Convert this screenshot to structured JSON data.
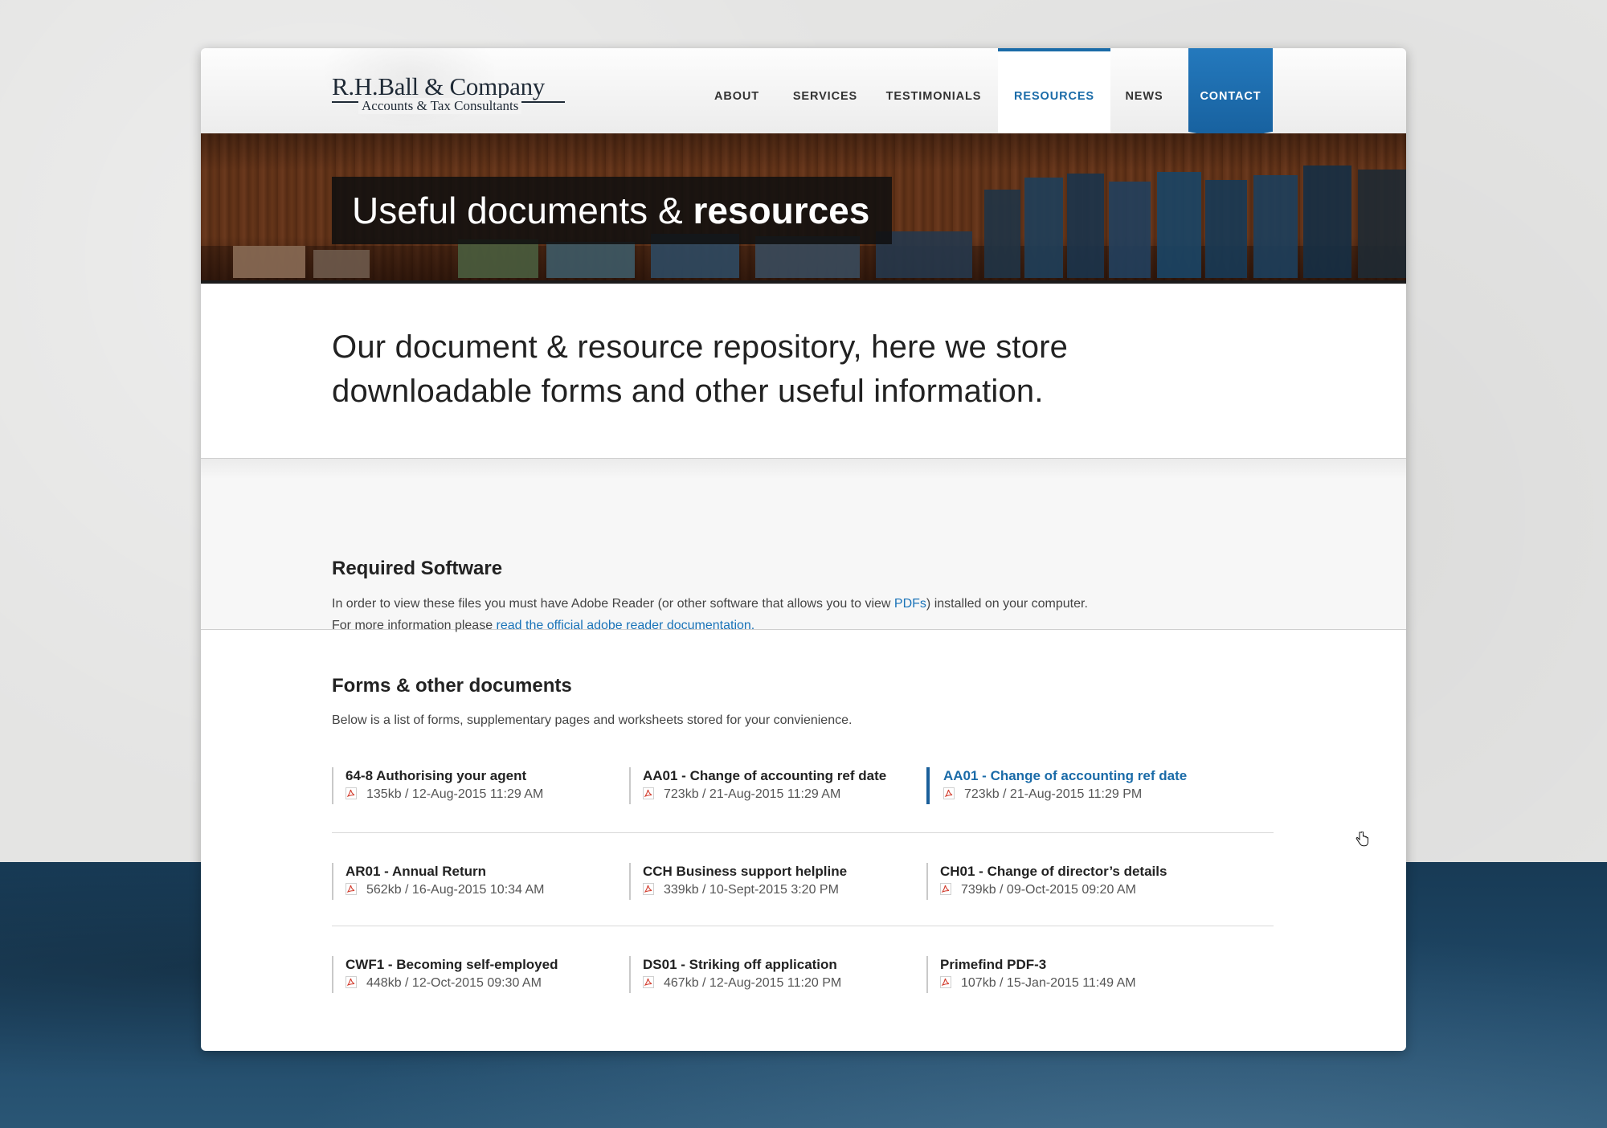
{
  "brand": {
    "name": "R.H.Ball & Company",
    "tagline": "Accounts & Tax Consultants"
  },
  "nav": {
    "about": "ABOUT",
    "services": "SERVICES",
    "testimonials": "TESTIMONIALS",
    "resources": "RESOURCES",
    "news": "NEWS",
    "contact": "CONTACT",
    "active": "RESOURCES"
  },
  "banner": {
    "title_light": "Useful documents &",
    "title_bold": "resources"
  },
  "intro": {
    "text": "Our document & resource repository, here we store downloadable forms and other useful information."
  },
  "software": {
    "title": "Required Software",
    "line1_before": "In order to view these files you must have Adobe Reader (or other software that allows you to view ",
    "line1_link": "PDFs",
    "line1_after": ") installed on your computer.",
    "line2_before": "For more information please ",
    "line2_link": "read the official adobe reader documentation."
  },
  "forms": {
    "title": "Forms & other documents",
    "subtitle": "Below is a list of forms, supplementary pages and worksheets stored for your convienience.",
    "documents": [
      {
        "title": "64-8 Authorising your agent",
        "meta": "135kb / 12-Aug-2015 11:29 AM"
      },
      {
        "title": "AA01 - Change of accounting ref date",
        "meta": "723kb / 21-Aug-2015 11:29 AM"
      },
      {
        "title": "AA01 - Change of accounting ref date",
        "meta": "723kb / 21-Aug-2015 11:29 PM"
      },
      {
        "title": "AR01 - Annual Return",
        "meta": "562kb / 16-Aug-2015 10:34 AM"
      },
      {
        "title": "CCH Business support helpline",
        "meta": "339kb / 10-Sept-2015 3:20 PM"
      },
      {
        "title": "CH01 - Change of director’s details",
        "meta": "739kb / 09-Oct-2015 09:20 AM"
      },
      {
        "title": "CWF1 - Becoming self-employed",
        "meta": "448kb / 12-Oct-2015 09:30 AM"
      },
      {
        "title": "DS01 - Striking off application",
        "meta": "467kb / 12-Aug-2015 11:20 PM"
      },
      {
        "title": "Primefind PDF-3",
        "meta": "107kb / 15-Jan-2015 11:49 AM"
      }
    ]
  },
  "colors": {
    "accent": "#1a6ba8",
    "contact_bg": "#1f6fb0",
    "footer_bg": "#1c4260",
    "pdf_icon": "#d23b2c"
  },
  "icons": {
    "document": "pdf-icon",
    "cursor": "hand-pointer-icon"
  }
}
